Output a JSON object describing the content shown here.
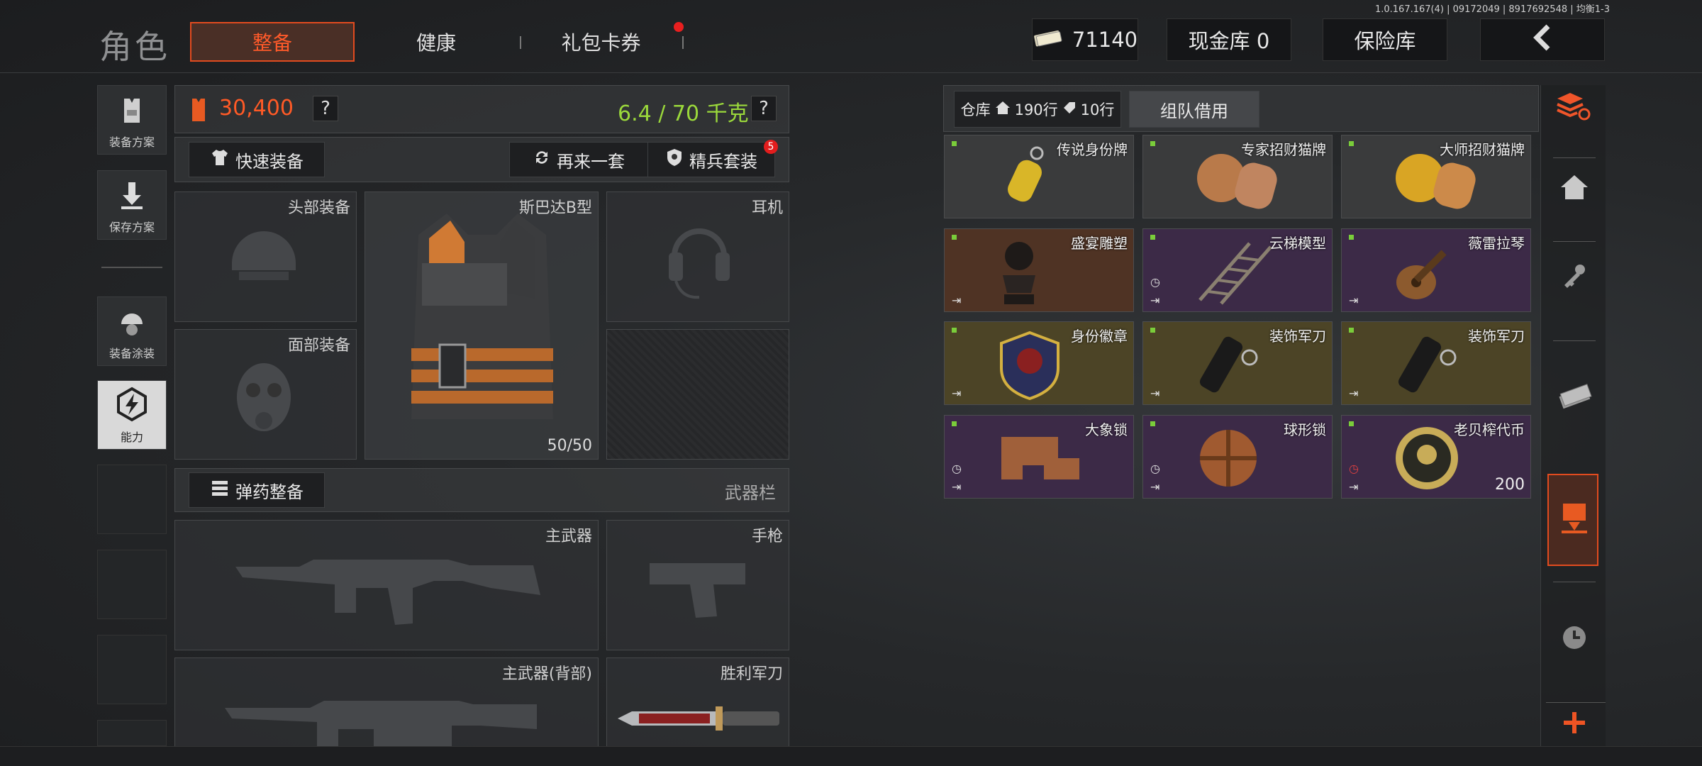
{
  "version": "1.0.167.167(4) | 09172049 | 8917692548 | 均衡1-3",
  "nav": {
    "title": "角色",
    "tabs": [
      {
        "label": "整备",
        "active": true
      },
      {
        "label": "健康",
        "active": false
      },
      {
        "label": "礼包卡券",
        "active": false
      }
    ]
  },
  "topbar": {
    "money": "71140",
    "cash_vault": "现金库 0",
    "insurance": "保险库",
    "back_icon": "chevron-left-icon"
  },
  "left_rail": [
    {
      "label": "装备方案",
      "icon": "vest-icon"
    },
    {
      "label": "保存方案",
      "icon": "download-icon"
    },
    {
      "label": "装备涂装",
      "icon": "helmet-paint-icon"
    },
    {
      "label": "能力",
      "icon": "lightning-hex-icon",
      "selected": true
    }
  ],
  "loadout": {
    "value": "30,400",
    "weight": "6.4 / 70 千克",
    "quick_equip": "快速装备",
    "again": "再来一套",
    "elite": "精兵套装",
    "elite_badge": "5",
    "slots": {
      "head": "头部装备",
      "face": "面部装备",
      "armor": "斯巴达B型",
      "armor_durability": "50/50",
      "headset": "耳机"
    },
    "ammo_btn": "弹药整备",
    "weapon_bar": "武器栏",
    "weapons": {
      "primary": "主武器",
      "pistol": "手枪",
      "primary_back": "主武器(背部)",
      "knife": "胜利军刀"
    }
  },
  "warehouse": {
    "label": "仓库",
    "rows": "190行",
    "rows2": "10行",
    "team_borrow": "组队借用",
    "items": [
      {
        "name": "传说身份牌",
        "color": "gray",
        "icon": "dogtag-icon"
      },
      {
        "name": "专家招财猫牌",
        "color": "gray",
        "icon": "lucky-cat-icon"
      },
      {
        "name": "大师招财猫牌",
        "color": "gray",
        "icon": "lucky-cat-gold-icon"
      },
      {
        "name": "盛宴雕塑",
        "color": "brown",
        "icon": "bust-icon"
      },
      {
        "name": "云梯模型",
        "color": "purple",
        "icon": "ladder-icon"
      },
      {
        "name": "薇雷拉琴",
        "color": "purple",
        "icon": "guitar-icon"
      },
      {
        "name": "身份徽章",
        "color": "gold",
        "icon": "badge-icon"
      },
      {
        "name": "装饰军刀",
        "color": "gold",
        "icon": "lighter-icon"
      },
      {
        "name": "装饰军刀",
        "color": "gold",
        "icon": "lighter-icon"
      },
      {
        "name": "大象锁",
        "color": "purple",
        "icon": "wood-puzzle-icon"
      },
      {
        "name": "球形锁",
        "color": "purple",
        "icon": "ball-puzzle-icon"
      },
      {
        "name": "老贝榨代币",
        "color": "purple",
        "icon": "coin-icon",
        "count": "200"
      }
    ]
  },
  "right_rail": [
    "stack-refresh-icon",
    "home-icon",
    "key-icon",
    "cash-icon",
    "box-arrow-icon",
    "clock-icon",
    "plus-icon"
  ]
}
